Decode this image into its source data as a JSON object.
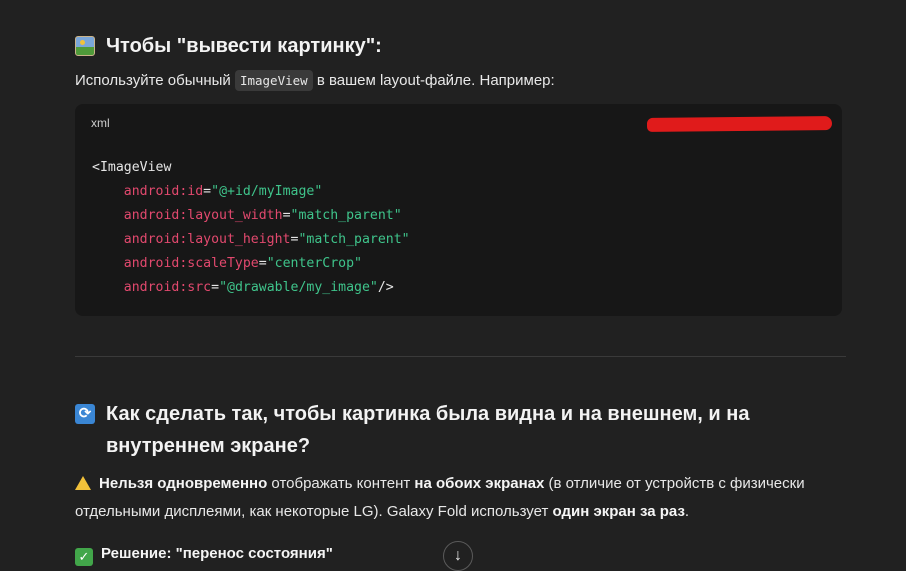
{
  "section1": {
    "icon": "framed-picture-icon",
    "heading": "Чтобы \"вывести картинку\":",
    "intro_before": "Используйте обычный ",
    "intro_code": "ImageView",
    "intro_after": " в вашем layout-файле. Например:"
  },
  "code_block": {
    "language": "xml",
    "lines": [
      {
        "tag": "<ImageView"
      },
      {
        "attr": "android:id",
        "eq": "=",
        "value": "\"@+id/myImage\""
      },
      {
        "attr": "android:layout_width",
        "eq": "=",
        "value": "\"match_parent\""
      },
      {
        "attr": "android:layout_height",
        "eq": "=",
        "value": "\"match_parent\""
      },
      {
        "attr": "android:scaleType",
        "eq": "=",
        "value": "\"centerCrop\""
      },
      {
        "attr": "android:src",
        "eq": "=",
        "value": "\"@drawable/my_image\"",
        "close": "/>"
      }
    ]
  },
  "section2": {
    "icon": "refresh-arrows-icon",
    "heading": "Как сделать так, чтобы картинка была видна и на внешнем, и на внутреннем экране?",
    "warning": {
      "bold1": "Нельзя одновременно",
      "text1": " отображать контент ",
      "bold2": "на обоих экранах",
      "text2": " (в отличие от устройств с физически отдельными дисплеями, как некоторые LG). Galaxy Fold использует ",
      "bold3": "один экран за раз",
      "text3": "."
    },
    "solution_label": "Решение: \"перенос состояния\""
  },
  "scroll_down": {
    "icon": "arrow-down-icon",
    "glyph": "↓"
  },
  "colors": {
    "background": "#212121",
    "code_bg": "#171717",
    "attr": "#e2496e",
    "string": "#3fc48b"
  }
}
